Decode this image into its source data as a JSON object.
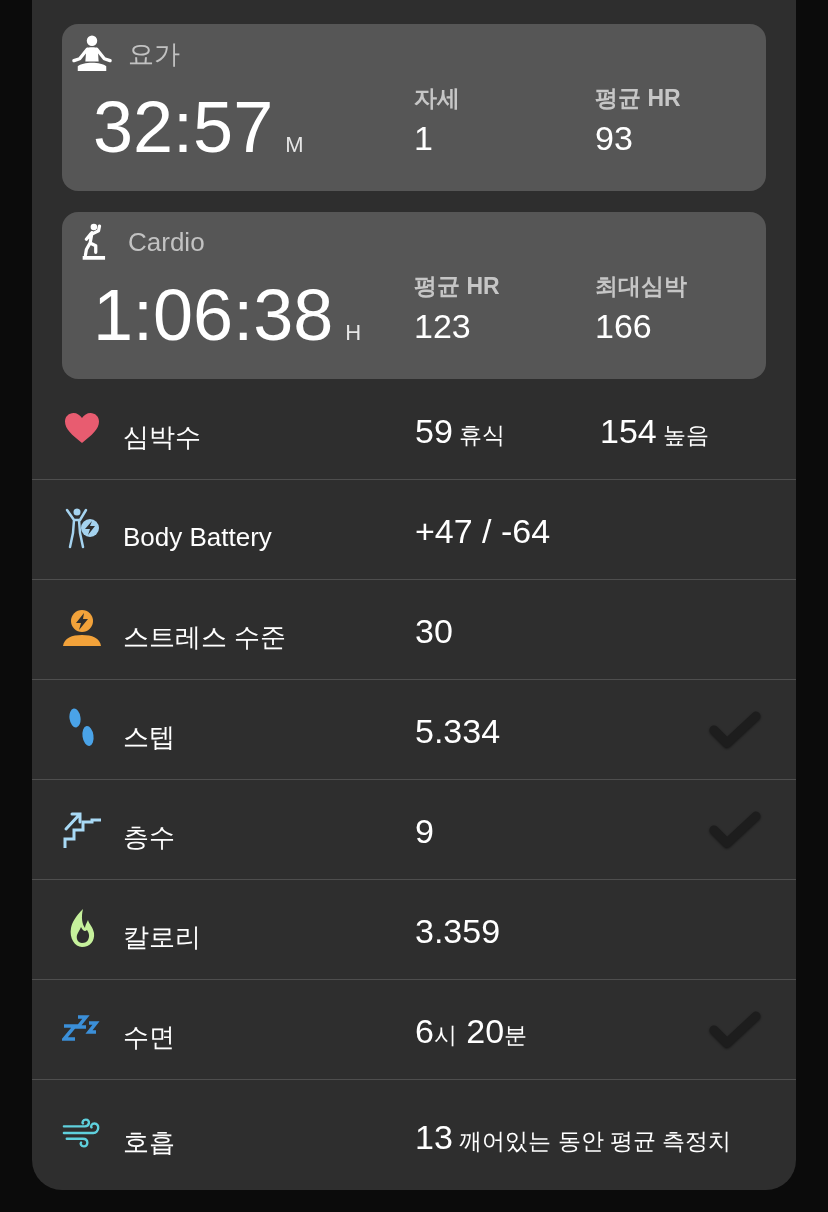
{
  "activities": [
    {
      "kind": "yoga",
      "title": "요가",
      "duration": "32:57",
      "unit": "M",
      "stats": [
        {
          "label": "자세",
          "value": "1"
        },
        {
          "label": "평균 HR",
          "value": "93"
        }
      ]
    },
    {
      "kind": "cardio",
      "title": "Cardio",
      "duration": "1:06:38",
      "unit": "H",
      "stats": [
        {
          "label": "평균 HR",
          "value": "123"
        },
        {
          "label": "최대심박",
          "value": "166"
        }
      ]
    }
  ],
  "metrics": [
    {
      "kind": "heart",
      "label": "심박수",
      "readings": [
        {
          "parts": [
            {
              "text": "59",
              "kind": "number"
            },
            {
              "text": " 휴식",
              "kind": "unit"
            }
          ]
        },
        {
          "parts": [
            {
              "text": "154",
              "kind": "number"
            },
            {
              "text": " 높음",
              "kind": "unit"
            }
          ]
        }
      ],
      "goal_met": false
    },
    {
      "kind": "battery",
      "label": "Body Battery",
      "readings": [
        {
          "parts": [
            {
              "text": "+47 / -64",
              "kind": "number"
            }
          ]
        }
      ],
      "goal_met": false
    },
    {
      "kind": "stress",
      "label": "스트레스 수준",
      "readings": [
        {
          "parts": [
            {
              "text": "30",
              "kind": "number"
            }
          ]
        }
      ],
      "goal_met": false
    },
    {
      "kind": "steps",
      "label": "스텝",
      "readings": [
        {
          "parts": [
            {
              "text": "5.334",
              "kind": "number"
            }
          ]
        }
      ],
      "goal_met": true
    },
    {
      "kind": "floors",
      "label": "층수",
      "readings": [
        {
          "parts": [
            {
              "text": "9",
              "kind": "number"
            }
          ]
        }
      ],
      "goal_met": true
    },
    {
      "kind": "calories",
      "label": "칼로리",
      "readings": [
        {
          "parts": [
            {
              "text": "3.359",
              "kind": "number"
            }
          ]
        }
      ],
      "goal_met": false
    },
    {
      "kind": "sleep",
      "label": "수면",
      "readings": [
        {
          "parts": [
            {
              "text": "6",
              "kind": "number"
            },
            {
              "text": "시",
              "kind": "unit"
            },
            {
              "text": " 20",
              "kind": "number"
            },
            {
              "text": "분",
              "kind": "unit"
            }
          ]
        }
      ],
      "goal_met": true
    },
    {
      "kind": "breathing",
      "label": "호흡",
      "readings": [
        {
          "parts": [
            {
              "text": "13",
              "kind": "number"
            },
            {
              "text": " 깨어있는 동안 평균 측정치",
              "kind": "unit"
            }
          ]
        }
      ],
      "goal_met": false
    }
  ]
}
